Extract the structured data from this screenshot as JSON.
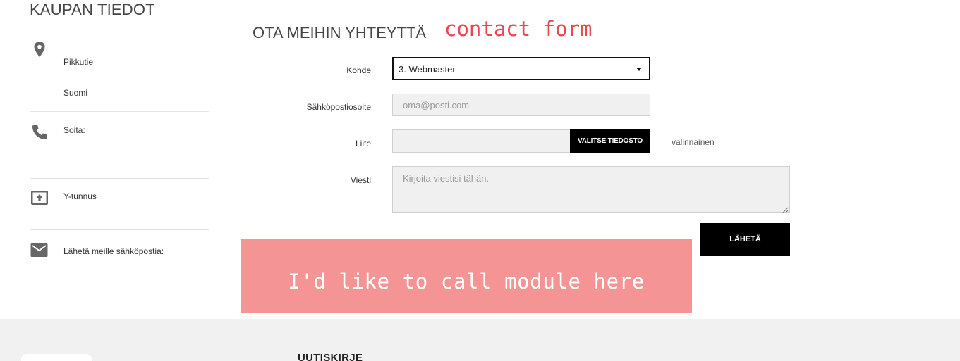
{
  "store_info": {
    "title": "KAUPAN TIEDOT",
    "address": {
      "icon": "map-pin-icon",
      "lines": [
        "Pikkutie",
        "Suomi"
      ]
    },
    "phone": {
      "icon": "phone-icon",
      "label": "Soita:"
    },
    "business_id": {
      "icon": "id-card-icon",
      "label": "Y-tunnus"
    },
    "email": {
      "icon": "envelope-icon",
      "label": "Lähetä meille sähköpostia:"
    }
  },
  "contact": {
    "title": "OTA MEIHIN YHTEYTTÄ",
    "annotation": "contact form",
    "subject_label": "Kohde",
    "subject_selected": "3. Webmaster",
    "email_label": "Sähköpostiosoite",
    "email_placeholder": "oma@posti.com",
    "attachment_label": "Liite",
    "file_button": "VALITSE TIEDOSTO",
    "optional_note": "valinnainen",
    "message_label": "Viesti",
    "message_placeholder": "Kirjoita viestisi tähän.",
    "submit": "LÄHETÄ"
  },
  "module_placeholder": "I'd like to call module here",
  "footer": {
    "newsletter_title": "UUTISKIRJE"
  },
  "colors": {
    "annotation_red": "#e8474f",
    "module_pink": "#f49494",
    "button_black": "#000000",
    "icon_gray": "#666666",
    "footer_bg": "#f1f1f1"
  }
}
